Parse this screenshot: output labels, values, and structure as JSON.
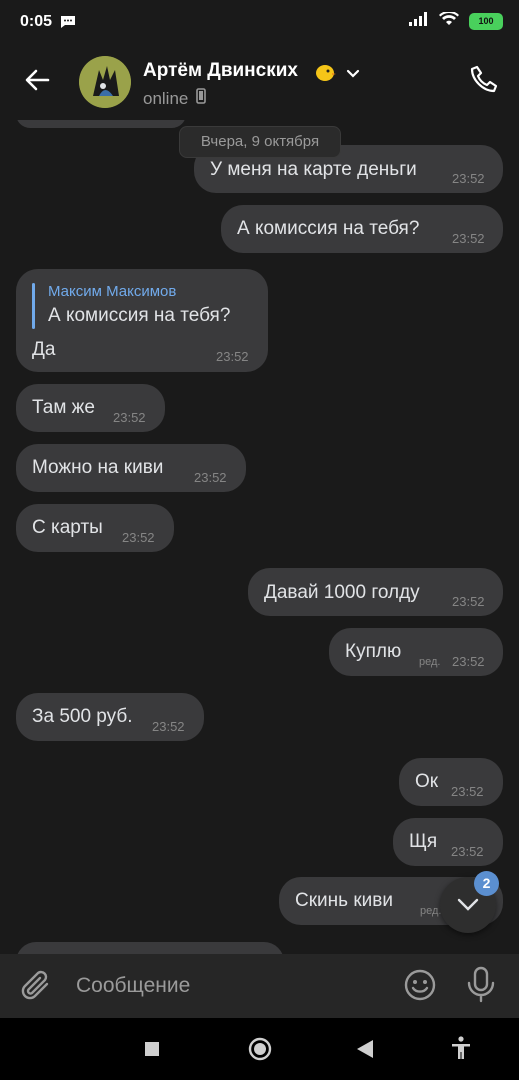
{
  "status_bar": {
    "time": "0:05",
    "battery": "100",
    "message_icon": "message-notification-icon",
    "icons": [
      "signal-icon",
      "wifi-icon",
      "battery-icon"
    ]
  },
  "header": {
    "contact_name": "Артём Двинских",
    "status": "online",
    "icons": [
      "back-arrow-icon",
      "emoji-chick-icon",
      "chevron-down-icon",
      "phone-device-icon",
      "phone-call-icon"
    ]
  },
  "date_divider": "Вчера, 9 октября",
  "messages": [
    {
      "text": "У меня на карте деньги",
      "time": "23:52",
      "outgoing": true
    },
    {
      "text": "А комиссия на тебя?",
      "time": "23:52",
      "outgoing": true
    },
    {
      "reply_name": "Максим Максимов",
      "reply_text": "А комиссия на тебя?",
      "text": "Да",
      "time": "23:52",
      "outgoing": false
    },
    {
      "text": "Там же",
      "time": "23:52",
      "outgoing": false
    },
    {
      "text": "Можно на киви",
      "time": "23:52",
      "outgoing": false
    },
    {
      "text": "С карты",
      "time": "23:52",
      "outgoing": false
    },
    {
      "text": "Давай 1000 голду",
      "time": "23:52",
      "outgoing": true
    },
    {
      "text": "Куплю",
      "edited": "ред.",
      "time": "23:52",
      "outgoing": true
    },
    {
      "text": "За 500 руб.",
      "time": "23:52",
      "outgoing": false
    },
    {
      "text": "Ок",
      "time": "23:52",
      "outgoing": true
    },
    {
      "text": "Щя",
      "time": "23:52",
      "outgoing": true
    },
    {
      "text": "Скинь киви",
      "edited": "ред.",
      "outgoing": true
    }
  ],
  "scroll_down": {
    "unread_count": "2"
  },
  "composer": {
    "placeholder": "Сообщение"
  },
  "colors": {
    "background": "#1a1a1a",
    "bubble": "#3a3a3c",
    "accent": "#71aaeb",
    "badge": "#5b8fd0",
    "battery": "#49d05c"
  }
}
